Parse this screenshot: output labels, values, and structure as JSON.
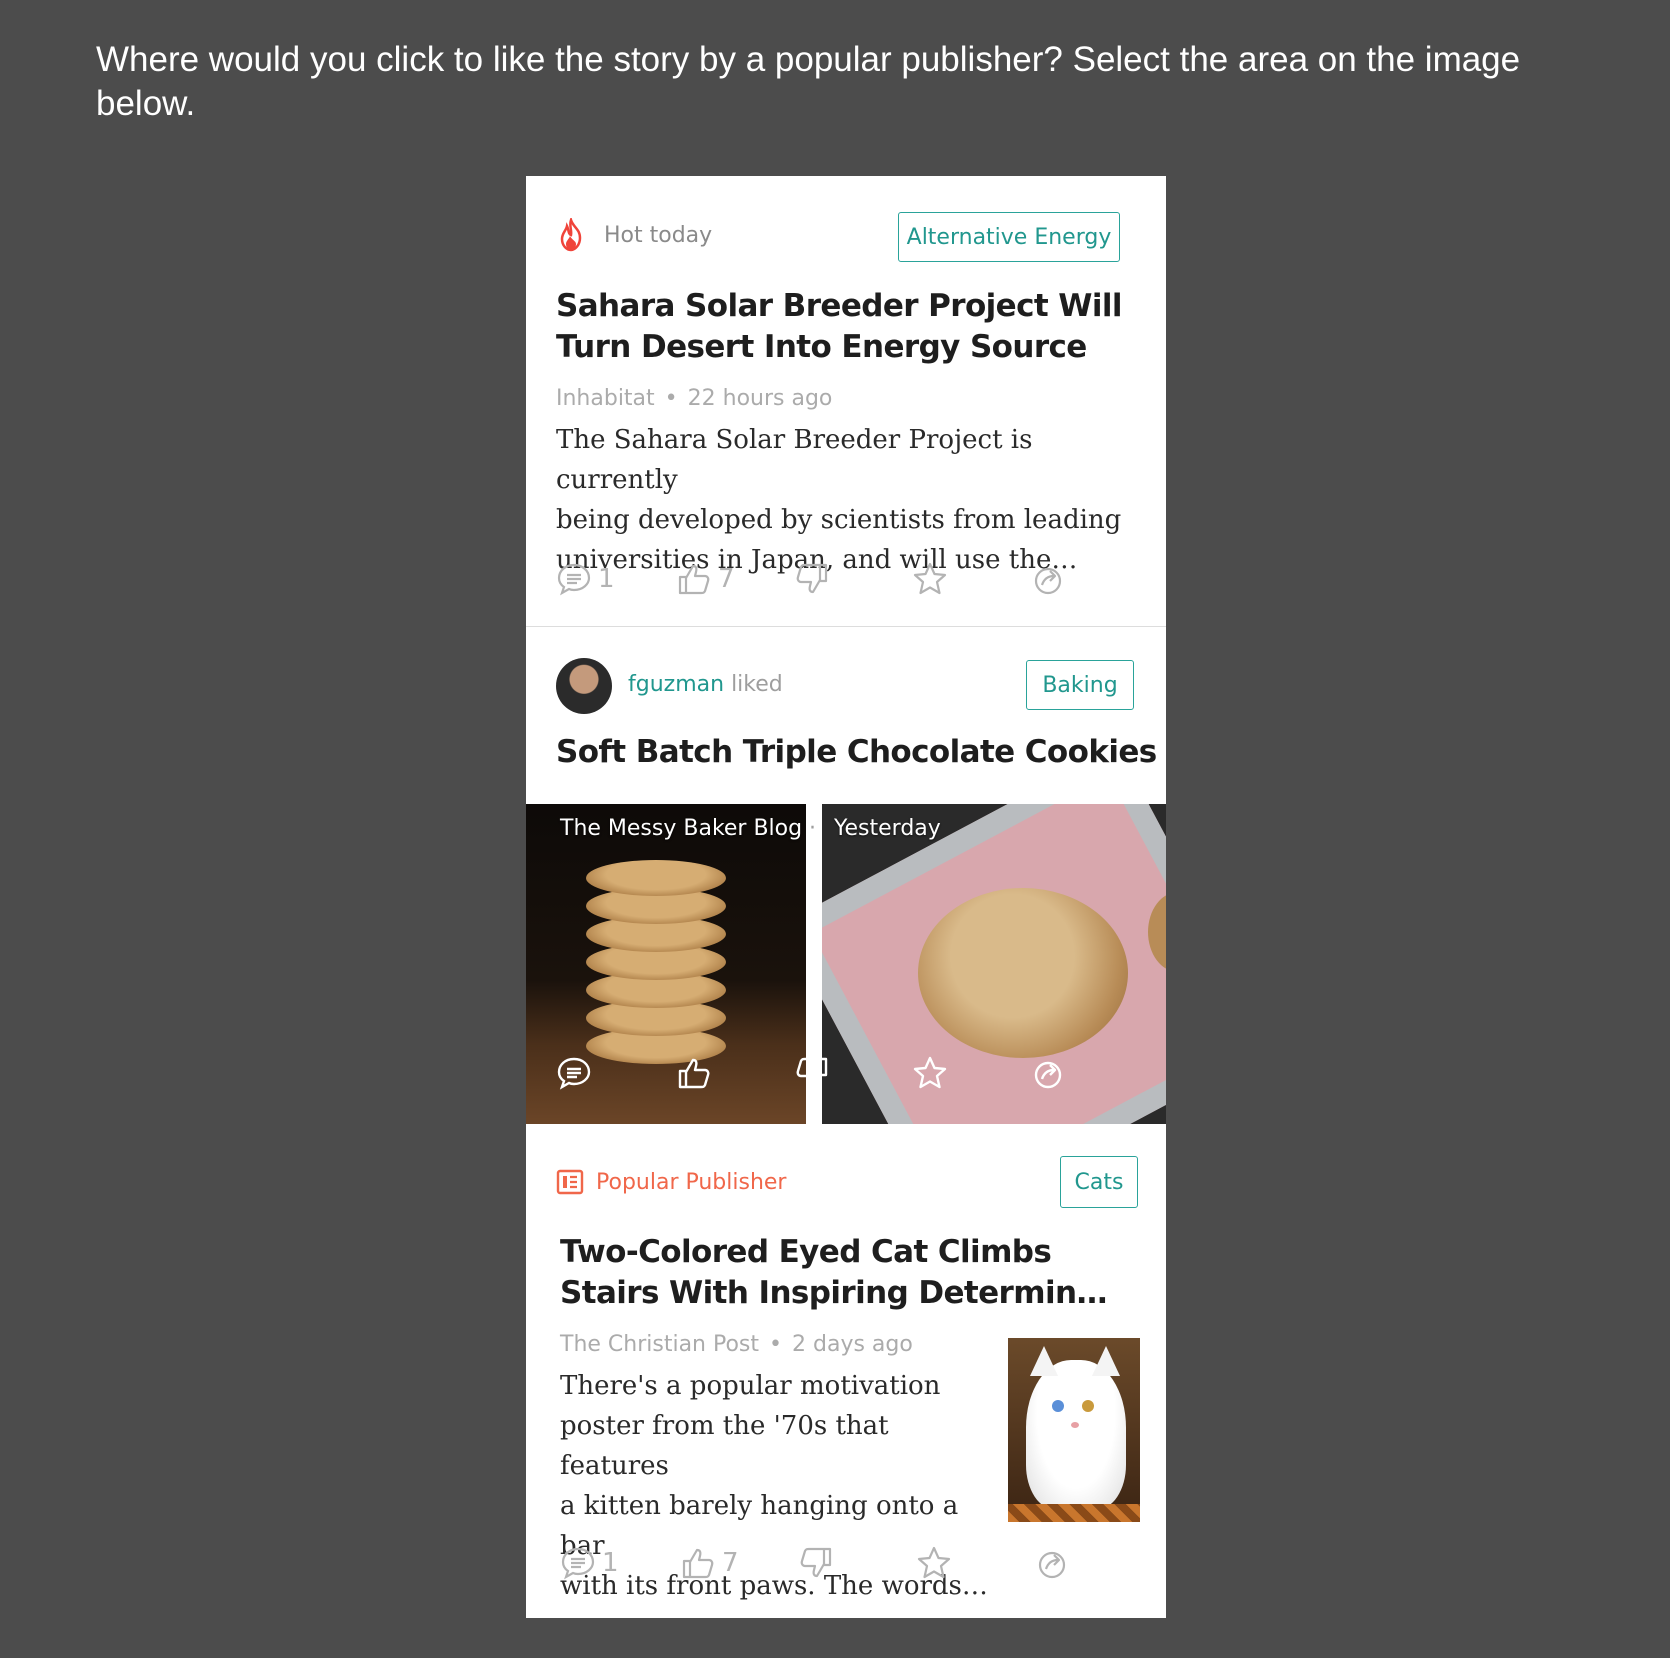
{
  "prompt": {
    "text": "Where would you click to like the story by a popular publisher? Select the area on the image below."
  },
  "card1": {
    "badge_label": "Hot today",
    "tag": "Alternative Energy",
    "headline_line1": "Sahara Solar Breeder Project Will",
    "headline_line2": "Turn Desert Into Energy Source",
    "source": "Inhabitat",
    "time": "22 hours ago",
    "summary_line1": "The Sahara Solar Breeder Project is currently",
    "summary_line2": "being developed by scientists from leading",
    "summary_line3": "universities in Japan, and will use the…",
    "comments": "1",
    "likes": "7"
  },
  "card2": {
    "user": "fguzman",
    "action": "liked",
    "tag": "Baking",
    "headline": "Soft Batch Triple Chocolate Cookies",
    "source": "The Messy Baker Blog",
    "separator": "·",
    "time": "Yesterday"
  },
  "card3": {
    "badge_label": "Popular Publisher",
    "tag": "Cats",
    "headline_line1": "Two-Colored Eyed Cat Climbs",
    "headline_line2": "Stairs With Inspiring Determin…",
    "source": "The Christian Post",
    "time": "2 days ago",
    "summary_line1": "There's a popular motivation",
    "summary_line2": "poster from the '70s that features",
    "summary_line3": "a kitten barely hanging onto a bar",
    "summary_line4": "with its front paws. The words…",
    "comments": "1",
    "likes": "7"
  },
  "colors": {
    "background": "#4c4c4c",
    "accent_teal": "#21978e",
    "hot_red": "#f0443a",
    "publisher_orange": "#f0674a"
  },
  "icons": [
    "flame-icon",
    "comment-icon",
    "thumbs-up-icon",
    "thumbs-down-icon",
    "star-icon",
    "share-icon",
    "publisher-icon"
  ]
}
